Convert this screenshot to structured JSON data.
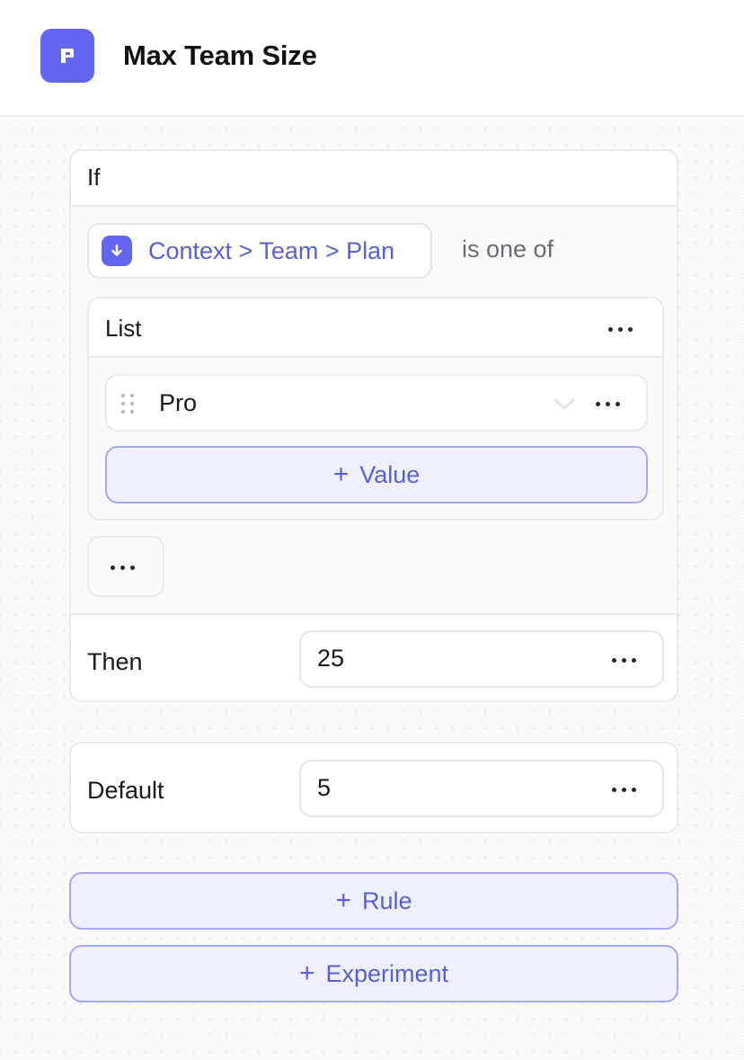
{
  "header": {
    "title": "Max Team Size",
    "icon": "flag-icon",
    "accent": "#6366f1"
  },
  "rule": {
    "if_label": "If",
    "context": {
      "icon": "arrow-down-circle-icon",
      "path": "Context > Team > Plan"
    },
    "operator": "is one of",
    "list": {
      "title": "List",
      "values": [
        "Pro"
      ],
      "add_value_label": "Value"
    },
    "then_label": "Then",
    "then_value": "25"
  },
  "default": {
    "label": "Default",
    "value": "5"
  },
  "actions": {
    "add_rule_label": "Rule",
    "add_experiment_label": "Experiment"
  }
}
